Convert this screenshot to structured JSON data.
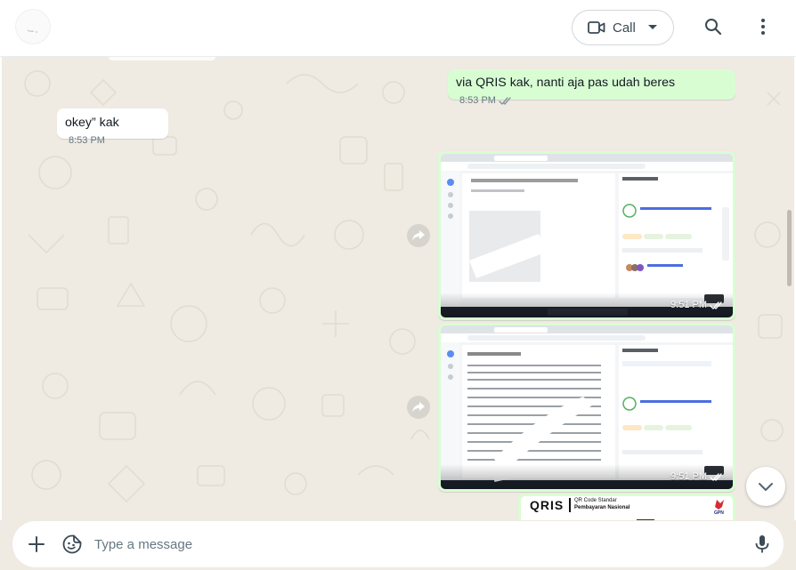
{
  "header": {
    "call_label": "Call",
    "icons": [
      "video-camera-icon",
      "chevron-down-icon",
      "search-icon",
      "menu-dots-icon"
    ]
  },
  "messages": [
    {
      "direction": "out",
      "text": "via QRIS kak, nanti aja pas udah beres",
      "time": "8:53 PM",
      "status": "read"
    },
    {
      "direction": "in",
      "text": "okey” kak",
      "time": "8:53 PM"
    },
    {
      "direction": "out",
      "type": "image",
      "time": "9:51 PM",
      "status": "read"
    },
    {
      "direction": "out",
      "type": "image",
      "time": "9:51 PM",
      "status": "read"
    },
    {
      "direction": "out",
      "type": "image",
      "caption_preview": "QRIS"
    }
  ],
  "qris": {
    "brand": "QRIS",
    "line1": "QR Code Standar",
    "line2": "Pembayaran Nasional",
    "badge": "GPN"
  },
  "composer": {
    "placeholder": "Type a message"
  },
  "colors": {
    "chat_bg": "#efeae2",
    "bubble_out": "#d9fdd3",
    "bubble_in": "#ffffff",
    "tick_read": "#53bdeb",
    "meta": "#667781"
  }
}
